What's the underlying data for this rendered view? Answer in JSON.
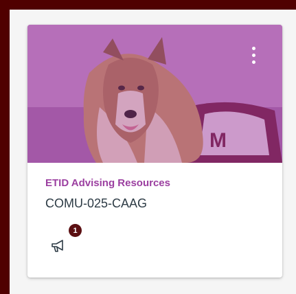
{
  "course_card": {
    "title": "ETID Advising Resources",
    "code": "COMU-025-CAAG",
    "hero_image": "collie-mascot-photo",
    "hero_tint": "#a03ca5",
    "title_color": "#9b3fa0",
    "options_icon": "kebab-menu-icon",
    "announcements": {
      "icon": "megaphone-icon",
      "unread_count": "1",
      "badge_color": "#5b0f12"
    }
  },
  "frame_color": "#500000"
}
